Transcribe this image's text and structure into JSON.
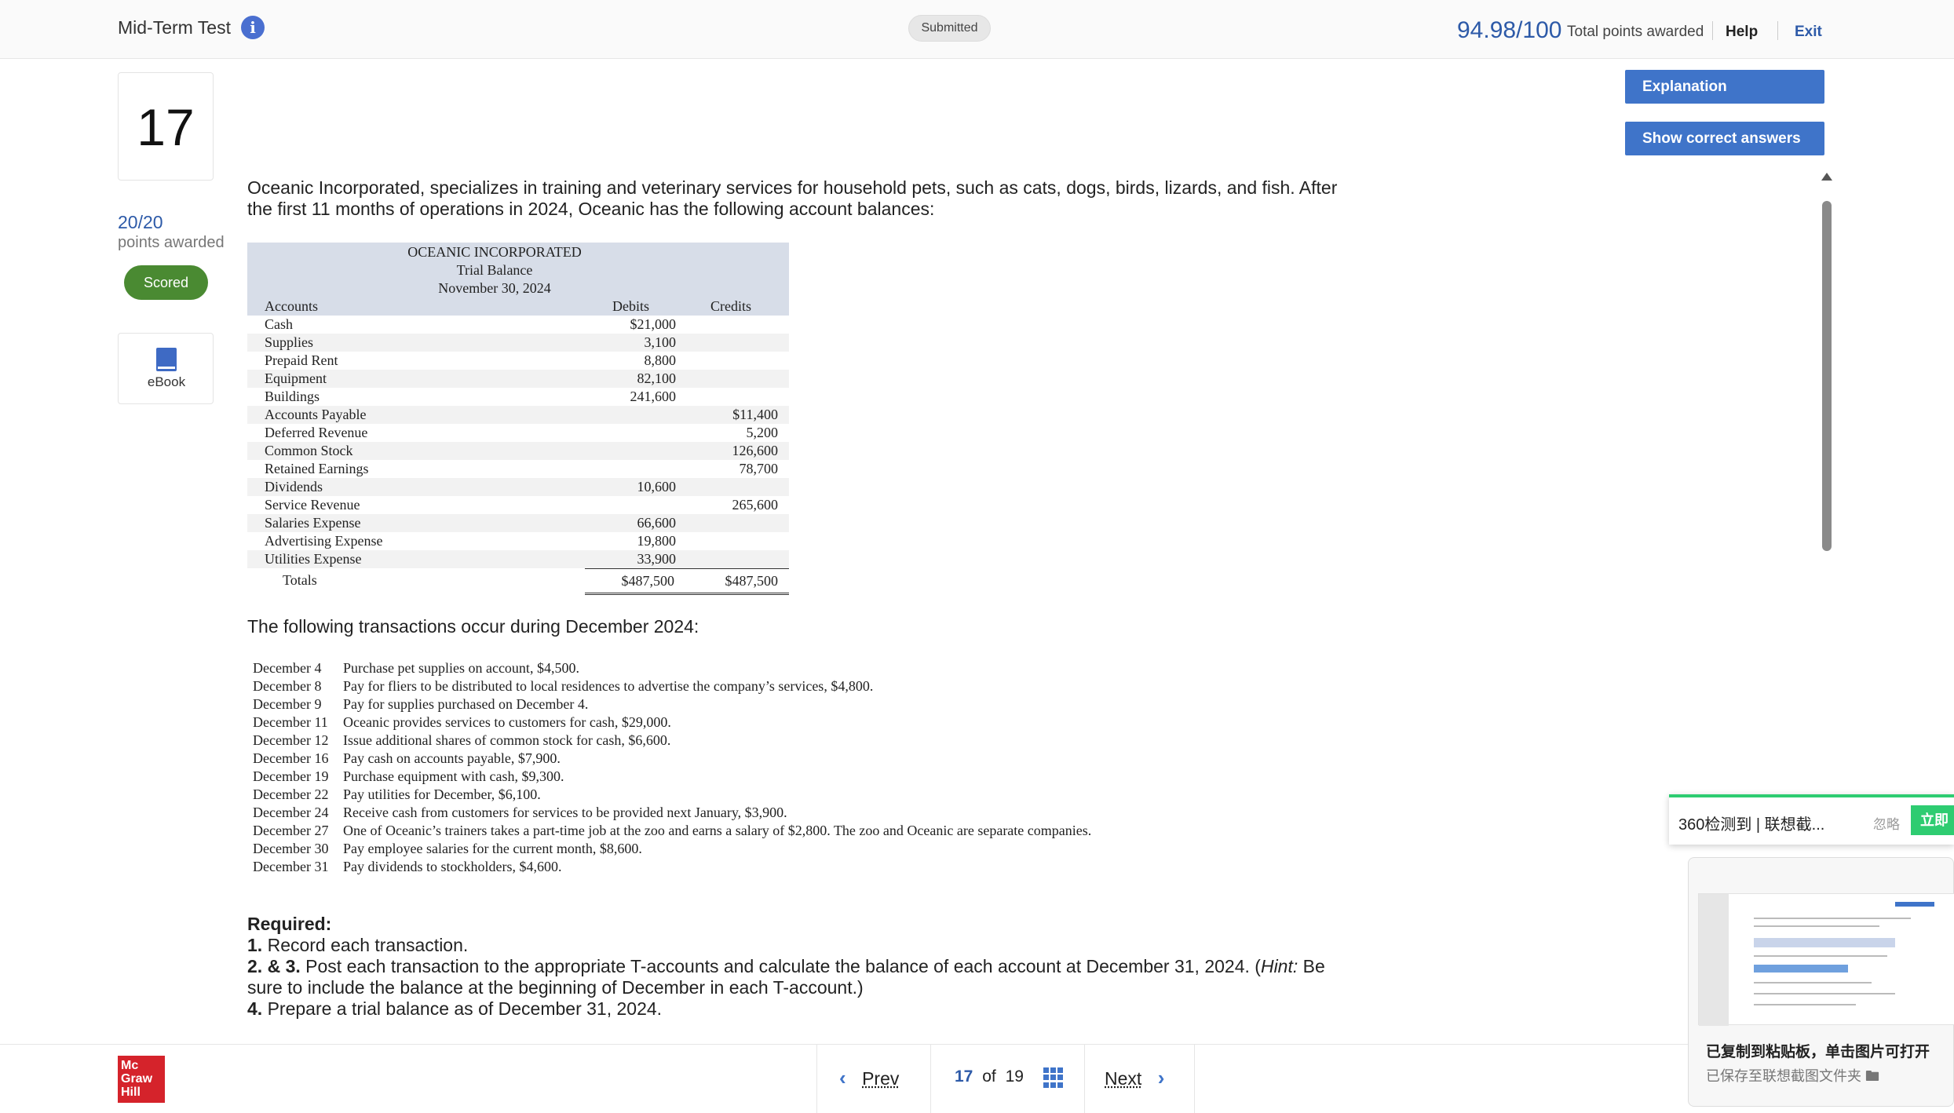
{
  "header": {
    "title": "Mid-Term Test",
    "status": "Submitted",
    "score": "94.98/100",
    "score_label": "Total points awarded",
    "help": "Help",
    "exit": "Exit"
  },
  "question": {
    "number": "17",
    "points_value": "20/20",
    "points_label": "points awarded",
    "scored_badge": "Scored",
    "ebook_label": "eBook"
  },
  "actions": {
    "explanation": "Explanation",
    "show_correct": "Show correct answers"
  },
  "intro_text": "Oceanic Incorporated, specializes in training and veterinary services for household pets, such as cats, dogs, birds, lizards, and fish. After the first 11 months of operations in 2024, Oceanic has the following account balances:",
  "trial_balance": {
    "company": "OCEANIC INCORPORATED",
    "title": "Trial Balance",
    "date": "November 30, 2024",
    "col_accounts": "Accounts",
    "col_debits": "Debits",
    "col_credits": "Credits",
    "rows": [
      {
        "account": "Cash",
        "debit": "$21,000",
        "credit": ""
      },
      {
        "account": "Supplies",
        "debit": "3,100",
        "credit": ""
      },
      {
        "account": "Prepaid Rent",
        "debit": "8,800",
        "credit": ""
      },
      {
        "account": "Equipment",
        "debit": "82,100",
        "credit": ""
      },
      {
        "account": "Buildings",
        "debit": "241,600",
        "credit": ""
      },
      {
        "account": "Accounts Payable",
        "debit": "",
        "credit": "$11,400"
      },
      {
        "account": "Deferred Revenue",
        "debit": "",
        "credit": "5,200"
      },
      {
        "account": "Common Stock",
        "debit": "",
        "credit": "126,600"
      },
      {
        "account": "Retained Earnings",
        "debit": "",
        "credit": "78,700"
      },
      {
        "account": "Dividends",
        "debit": "10,600",
        "credit": ""
      },
      {
        "account": "Service Revenue",
        "debit": "",
        "credit": "265,600"
      },
      {
        "account": "Salaries Expense",
        "debit": "66,600",
        "credit": ""
      },
      {
        "account": "Advertising Expense",
        "debit": "19,800",
        "credit": ""
      },
      {
        "account": "Utilities Expense",
        "debit": "33,900",
        "credit": ""
      }
    ],
    "totals_label": "Totals",
    "total_debit": "$487,500",
    "total_credit": "$487,500"
  },
  "transactions_intro": "The following transactions occur during December 2024:",
  "transactions": [
    {
      "date": "December 4",
      "text": "Purchase pet supplies on account, $4,500."
    },
    {
      "date": "December 8",
      "text": "Pay for fliers to be distributed to local residences to advertise the company’s services, $4,800."
    },
    {
      "date": "December 9",
      "text": "Pay for supplies purchased on December 4."
    },
    {
      "date": "December 11",
      "text": "Oceanic provides services to customers for cash, $29,000."
    },
    {
      "date": "December 12",
      "text": "Issue additional shares of common stock for cash, $6,600."
    },
    {
      "date": "December 16",
      "text": "Pay cash on accounts payable, $7,900."
    },
    {
      "date": "December 19",
      "text": "Purchase equipment with cash, $9,300."
    },
    {
      "date": "December 22",
      "text": "Pay utilities for December, $6,100."
    },
    {
      "date": "December 24",
      "text": "Receive cash from customers for services to be provided next January, $3,900."
    },
    {
      "date": "December 27",
      "text": "One of Oceanic’s trainers takes a part-time job at the zoo and earns a salary of $2,800. The zoo and Oceanic are separate companies."
    },
    {
      "date": "December 30",
      "text": "Pay employee salaries for the current month, $8,600."
    },
    {
      "date": "December 31",
      "text": "Pay dividends to stockholders, $4,600."
    }
  ],
  "required": {
    "heading": "Required:",
    "items": [
      {
        "num": "1.",
        "text": " Record each transaction."
      },
      {
        "num": "2. & 3.",
        "text_before": " Post each transaction to the appropriate T-accounts and calculate the balance of each account at December 31, 2024. (",
        "hint": "Hint:",
        "text_after": " Be sure to include the balance at the beginning of December in each T-account.)"
      },
      {
        "num": "4.",
        "text": " Prepare a trial balance as of December 31, 2024."
      }
    ]
  },
  "footer": {
    "logo_lines": [
      "Mc",
      "Graw",
      "Hill"
    ],
    "prev": "Prev",
    "next": "Next",
    "current_page": "17",
    "of_text": "of",
    "total_pages": "19"
  },
  "toast": {
    "message": "360检测到 | 联想截...",
    "ignore": "忽略",
    "action": "立即"
  },
  "clipboard": {
    "title": "已复制到粘贴板，单击图片可打开",
    "subtitle": "已保存至联想截图文件夹"
  },
  "colors": {
    "accent_blue": "#3f74c9",
    "score_blue": "#2d5aa8",
    "scored_green": "#4a8a32",
    "toast_green": "#2ecc71",
    "table_header": "#d7dde8",
    "brand_red": "#d5232b"
  }
}
